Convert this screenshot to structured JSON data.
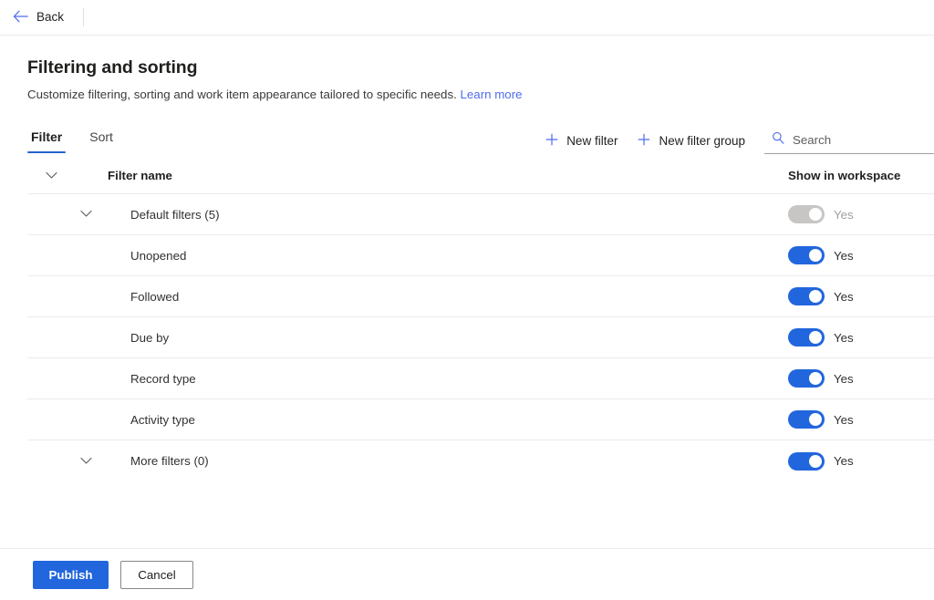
{
  "topbar": {
    "back_label": "Back",
    "back_icon": "arrow-left-icon"
  },
  "header": {
    "title": "Filtering and sorting",
    "subtitle": "Customize filtering, sorting and work item appearance tailored to specific needs.",
    "learn_more_label": "Learn more"
  },
  "tabs": [
    {
      "label": "Filter",
      "active": true
    },
    {
      "label": "Sort",
      "active": false
    }
  ],
  "commands": {
    "new_filter_label": "New filter",
    "new_filter_group_label": "New filter group",
    "plus_icon": "plus-icon"
  },
  "search": {
    "placeholder": "Search",
    "value": "",
    "icon": "search-icon"
  },
  "table": {
    "columns": {
      "filter_name": "Filter name",
      "show_in_workspace": "Show in workspace"
    },
    "rows": [
      {
        "label": "Default filters (5)",
        "group": true,
        "toggle_on": true,
        "toggle_disabled": true,
        "toggle_label": "Yes"
      },
      {
        "label": "Unopened",
        "group": false,
        "toggle_on": true,
        "toggle_disabled": false,
        "toggle_label": "Yes"
      },
      {
        "label": "Followed",
        "group": false,
        "toggle_on": true,
        "toggle_disabled": false,
        "toggle_label": "Yes"
      },
      {
        "label": "Due by",
        "group": false,
        "toggle_on": true,
        "toggle_disabled": false,
        "toggle_label": "Yes"
      },
      {
        "label": "Record type",
        "group": false,
        "toggle_on": true,
        "toggle_disabled": false,
        "toggle_label": "Yes"
      },
      {
        "label": "Activity type",
        "group": false,
        "toggle_on": true,
        "toggle_disabled": false,
        "toggle_label": "Yes"
      },
      {
        "label": "More filters (0)",
        "group": true,
        "toggle_on": true,
        "toggle_disabled": false,
        "toggle_label": "Yes"
      }
    ]
  },
  "footer": {
    "publish_label": "Publish",
    "cancel_label": "Cancel"
  },
  "colors": {
    "accent": "#2266dd",
    "link": "#4f6bed",
    "tab_underline": "#2564cf",
    "toggle_on": "#2266dd",
    "toggle_disabled": "#c8c6c4",
    "divider": "#edebe9"
  }
}
